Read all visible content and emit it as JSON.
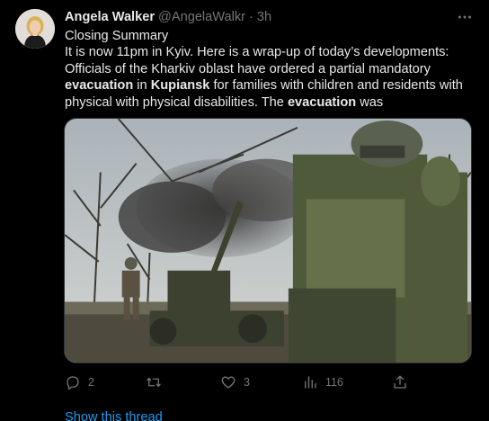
{
  "tweet": {
    "author_name": "Angela Walker",
    "author_handle": "@AngelaWalkr",
    "separator": "·",
    "time": "3h",
    "more_icon": "more-horizontal-icon",
    "text": {
      "line1": "Closing Summary",
      "line2": "It is now 11pm in Kyiv. Here is a wrap-up of today’s developments:",
      "line3": "Officials of the Kharkiv oblast have ordered a partial mandatory",
      "line4_b1": "evacuation",
      "line4_m1": " in ",
      "line4_b2": "Kupiansk",
      "line4_m2": " for families with children and residents with",
      "line5_a": "physical with physical disabilities. The ",
      "line5_b": "evacuation",
      "line5_c": " was"
    },
    "media_image": "artillery crew firing howitzer with soldier covering ears"
  },
  "actions": {
    "reply_icon": "reply-icon",
    "reply_count": "2",
    "retweet_icon": "retweet-icon",
    "like_icon": "heart-icon",
    "like_count": "3",
    "views_icon": "views-chart-icon",
    "views_count": "116",
    "share_icon": "share-icon"
  },
  "footer": {
    "show_thread": "Show this thread"
  },
  "colors": {
    "background": "#000000",
    "text_primary": "#e7e9ea",
    "text_secondary": "#71767b",
    "link": "#1d9bf0"
  }
}
